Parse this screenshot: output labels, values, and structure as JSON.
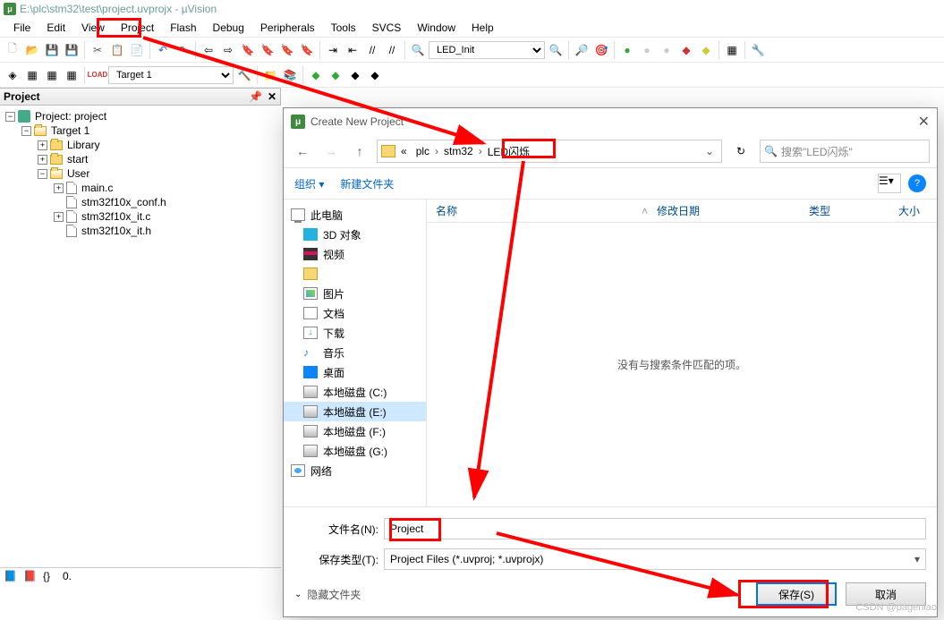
{
  "title": "E:\\plc\\stm32\\test\\project.uvprojx - µVision",
  "app_icon_char": "μ",
  "menubar": [
    "File",
    "Edit",
    "View",
    "Project",
    "Flash",
    "Debug",
    "Peripherals",
    "Tools",
    "SVCS",
    "Window",
    "Help"
  ],
  "toolbar1": {
    "combo": "LED_Init"
  },
  "toolbar2": {
    "target": "Target 1"
  },
  "project_panel": {
    "title": "Project",
    "root": "Project: project",
    "target": "Target 1",
    "groups": [
      {
        "name": "Library",
        "open": false
      },
      {
        "name": "start",
        "open": false
      },
      {
        "name": "User",
        "open": true,
        "files": [
          "main.c",
          "stm32f10x_conf.h",
          "stm32f10x_it.c",
          "stm32f10x_it.h"
        ]
      }
    ]
  },
  "dialog": {
    "title": "Create New Project",
    "crumbs": [
      "«",
      "plc",
      "stm32",
      "LED闪烁"
    ],
    "search_placeholder": "搜索\"LED闪烁\"",
    "toolbar": {
      "organize": "组织 ▾",
      "newfolder": "新建文件夹"
    },
    "sidebar": [
      {
        "name": "此电脑",
        "icon": "si-pc",
        "indent": 0
      },
      {
        "name": "3D 对象",
        "icon": "si-3d",
        "indent": 1
      },
      {
        "name": "视频",
        "icon": "si-video",
        "indent": 1
      },
      {
        "name": "",
        "icon": "si-folder",
        "indent": 1
      },
      {
        "name": "图片",
        "icon": "si-pic",
        "indent": 1
      },
      {
        "name": "文档",
        "icon": "si-doc",
        "indent": 1
      },
      {
        "name": "下载",
        "icon": "si-dl",
        "indent": 1
      },
      {
        "name": "音乐",
        "icon": "si-music",
        "indent": 1
      },
      {
        "name": "桌面",
        "icon": "si-desk",
        "indent": 1
      },
      {
        "name": "本地磁盘 (C:)",
        "icon": "si-disk",
        "indent": 1
      },
      {
        "name": "本地磁盘 (E:)",
        "icon": "si-disk",
        "indent": 1,
        "selected": true
      },
      {
        "name": "本地磁盘 (F:)",
        "icon": "si-disk",
        "indent": 1
      },
      {
        "name": "本地磁盘 (G:)",
        "icon": "si-disk",
        "indent": 1
      },
      {
        "name": "网络",
        "icon": "si-net",
        "indent": 0
      }
    ],
    "columns": {
      "name": "名称",
      "date": "修改日期",
      "type": "类型",
      "size": "大小"
    },
    "empty_msg": "没有与搜索条件匹配的项。",
    "filename_label": "文件名(N):",
    "filename_value": "Project",
    "savetype_label": "保存类型(T):",
    "savetype_value": "Project Files (*.uvproj; *.uvprojx)",
    "hide_folders": "隐藏文件夹",
    "save_btn": "保存(S)",
    "cancel_btn": "取消"
  },
  "watermark": "CSDN @pageniao"
}
